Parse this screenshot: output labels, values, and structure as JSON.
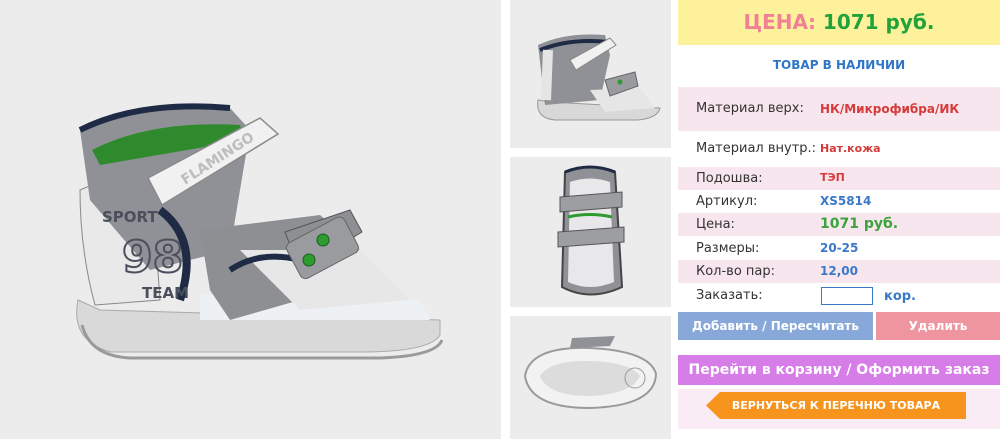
{
  "price_header": {
    "label": "ЦЕНА:",
    "value": "1071 руб."
  },
  "stock_status": "ТОВАР В НАЛИЧИИ",
  "specs": [
    {
      "key": "Материал верх:",
      "value": "НК/Микрофибра/ИК"
    },
    {
      "key": "Материал внутр.:",
      "value": "Нат.кожа"
    },
    {
      "key": "Подошва:",
      "value": "ТЭП"
    },
    {
      "key": "Артикул:",
      "value": "XS5814"
    },
    {
      "key": "Цена:",
      "value": "1071 руб."
    },
    {
      "key": "Размеры:",
      "value": "20-25"
    },
    {
      "key": "Кол-во пар:",
      "value": "12,00"
    }
  ],
  "order": {
    "label": "Заказать:",
    "value": "",
    "unit": "кор."
  },
  "buttons": {
    "add": "Добавить / Пересчитать",
    "delete": "Удалить",
    "checkout": "Перейти в корзину / Оформить заказ",
    "back": "ВЕРНУТЬСЯ К ПЕРЕЧНЮ ТОВАРА"
  },
  "shoe_text": {
    "brand": "FLAMINGO",
    "sport": "SPORT",
    "number": "98",
    "team": "TEAM"
  },
  "colors": {
    "accent_green": "#22a33a",
    "price_pink": "#f08094",
    "link_blue": "#2f75c8",
    "button_orange": "#f7941d"
  }
}
